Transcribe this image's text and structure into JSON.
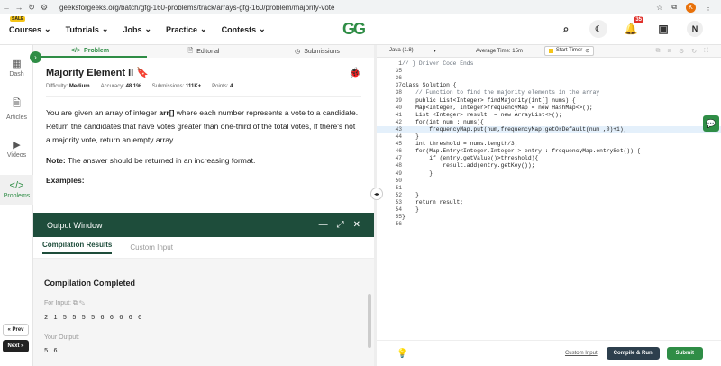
{
  "browser": {
    "url": "geeksforgeeks.org/batch/gfg-160-problems/track/arrays-gfg-160/problem/majority-vote",
    "profile": "K"
  },
  "topnav": {
    "sale": "SALE",
    "items": [
      "Courses",
      "Tutorials",
      "Jobs",
      "Practice",
      "Contests"
    ],
    "logo": "GG",
    "notif_count": "35",
    "avatar": "N"
  },
  "rail": {
    "items": [
      {
        "label": "Dash",
        "icon": "dashboard-icon",
        "glyph": "▦"
      },
      {
        "label": "Articles",
        "icon": "article-icon",
        "glyph": "🗎"
      },
      {
        "label": "Videos",
        "icon": "video-icon",
        "glyph": "▶"
      },
      {
        "label": "Problems",
        "icon": "code-icon",
        "glyph": "</>"
      }
    ],
    "prev": "« Prev",
    "next": "Next »"
  },
  "tabs": {
    "problem": "Problem",
    "editorial": "Editorial",
    "submissions": "Submissions"
  },
  "problem": {
    "title": "Majority Element II",
    "difficulty_label": "Difficulty:",
    "difficulty": "Medium",
    "accuracy_label": "Accuracy:",
    "accuracy": "48.1%",
    "submissions_label": "Submissions:",
    "submissions": "111K+",
    "points_label": "Points:",
    "points": "4",
    "desc_pre": "You are given an array of integer ",
    "desc_arr": "arr[]",
    "desc_post": " where each number represents a vote to a candidate. Return the candidates that have votes greater than one-third of the total votes, If there's not a majority vote, return an empty array.",
    "note_label": "Note:",
    "note_text": " The answer should be returned in an increasing format.",
    "examples": "Examples:"
  },
  "output": {
    "title": "Output Window",
    "tab_results": "Compilation Results",
    "tab_custom": "Custom Input",
    "status": "Compilation Completed",
    "input_label": "For Input:",
    "input_value": "2 1 5 5 5 5 6 6 6 6 6",
    "your_output_label": "Your Output:",
    "your_output_value": "5 6"
  },
  "editor_top": {
    "lang": "Java (1.8)",
    "avg_time": "Average Time: 15m",
    "timer": "Start Timer"
  },
  "code_lines": [
    {
      "n": "1",
      "t": "// } Driver Code Ends",
      "cls": "cm",
      "hl": false
    },
    {
      "n": "35",
      "t": "",
      "cls": "",
      "hl": false
    },
    {
      "n": "36",
      "t": "",
      "cls": "",
      "hl": false
    },
    {
      "n": "37",
      "t": "class Solution {",
      "cls": "",
      "hl": false
    },
    {
      "n": "38",
      "t": "    // Function to find the majority elements in the array",
      "cls": "cm",
      "hl": false
    },
    {
      "n": "39",
      "t": "    public List<Integer> findMajority(int[] nums) {",
      "cls": "",
      "hl": false
    },
    {
      "n": "40",
      "t": "    Map<Integer, Integer>frequencyMap = new HashMap<>();",
      "cls": "",
      "hl": false
    },
    {
      "n": "41",
      "t": "    List <Integer> result  = new ArrayList<>();",
      "cls": "",
      "hl": false
    },
    {
      "n": "42",
      "t": "    for(int num : nums){",
      "cls": "",
      "hl": false
    },
    {
      "n": "43",
      "t": "        frequencyMap.put(num,frequencyMap.getOrDefault(num ,0)+1);",
      "cls": "",
      "hl": true
    },
    {
      "n": "44",
      "t": "    }",
      "cls": "",
      "hl": false
    },
    {
      "n": "45",
      "t": "    int threshold = nums.length/3;",
      "cls": "",
      "hl": false
    },
    {
      "n": "46",
      "t": "    for(Map.Entry<Integer,Integer > entry : frequencyMap.entrySet()) {",
      "cls": "",
      "hl": false
    },
    {
      "n": "47",
      "t": "        if (entry.getValue()>threshold){",
      "cls": "",
      "hl": false
    },
    {
      "n": "48",
      "t": "            result.add(entry.getKey());",
      "cls": "",
      "hl": false
    },
    {
      "n": "49",
      "t": "        }",
      "cls": "",
      "hl": false
    },
    {
      "n": "50",
      "t": "",
      "cls": "",
      "hl": false
    },
    {
      "n": "51",
      "t": "",
      "cls": "",
      "hl": false
    },
    {
      "n": "52",
      "t": "    }",
      "cls": "",
      "hl": false
    },
    {
      "n": "53",
      "t": "    return result;",
      "cls": "",
      "hl": false
    },
    {
      "n": "54",
      "t": "    }",
      "cls": "",
      "hl": false
    },
    {
      "n": "55",
      "t": "}",
      "cls": "",
      "hl": false
    },
    {
      "n": "56",
      "t": "",
      "cls": "",
      "hl": false
    }
  ],
  "editor_bottom": {
    "custom_input": "Custom Input",
    "compile_run": "Compile & Run",
    "submit": "Submit"
  }
}
